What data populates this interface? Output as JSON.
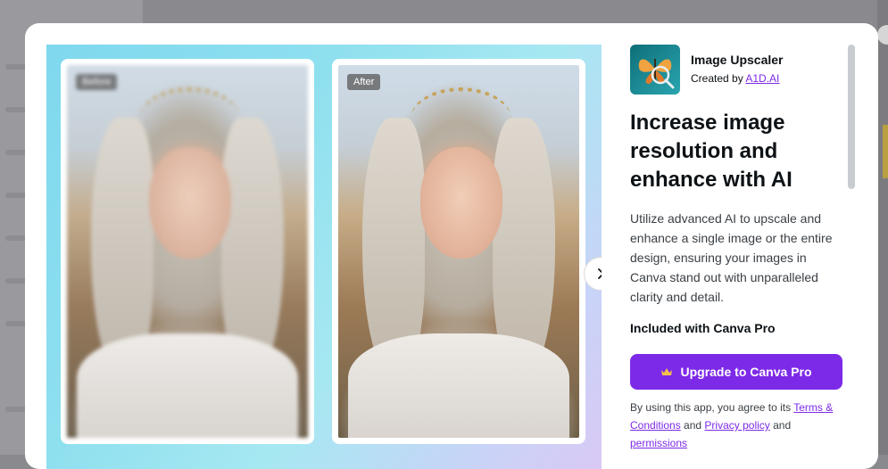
{
  "preview": {
    "before_label": "Before",
    "after_label": "After",
    "next_icon": "chevron-right-icon"
  },
  "app": {
    "name": "Image Upscaler",
    "created_by_prefix": "Created by",
    "creator": "A1D.AI",
    "icon": "butterfly-magnifier-icon"
  },
  "headline": "Increase image resolution and enhance with AI",
  "description": "Utilize advanced AI to upscale and enhance a single image or the entire design, ensuring your images in Canva stand out with unparalleled clarity and detail.",
  "included": "Included with Canva Pro",
  "upgrade_button": {
    "label": "Upgrade to Canva Pro",
    "icon": "crown-icon"
  },
  "legal": {
    "prefix": "By using this app, you agree to its",
    "terms": "Terms & Conditions",
    "and1": "and",
    "privacy": "Privacy policy",
    "and2": "and",
    "permissions": "permissions"
  },
  "colors": {
    "accent": "#7d2ae8",
    "text": "#0d1216",
    "backdrop": "#8a8a8e"
  }
}
